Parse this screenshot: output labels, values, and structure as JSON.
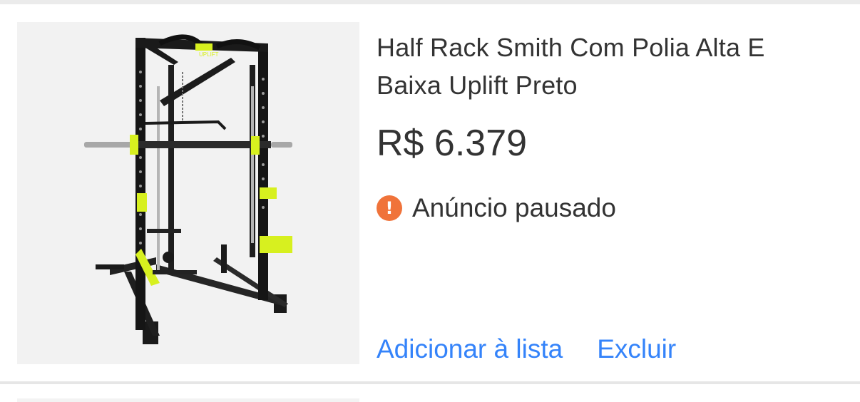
{
  "item": {
    "title_line1": "Half Rack Smith Com Polia Alta E",
    "title_line2": "Baixa Uplift Preto",
    "price": "R$ 6.379",
    "status": {
      "icon": "exclamation-icon",
      "text": "Anúncio pausado"
    },
    "actions": {
      "add_to_list": "Adicionar à lista",
      "delete": "Excluir"
    },
    "image_brand_mark": "UPLIFT"
  },
  "colors": {
    "link": "#3483fa",
    "warning": "#f0733a",
    "text": "#333333",
    "thumb_bg": "#f2f2f2",
    "accent_lime": "#d7f01f"
  }
}
